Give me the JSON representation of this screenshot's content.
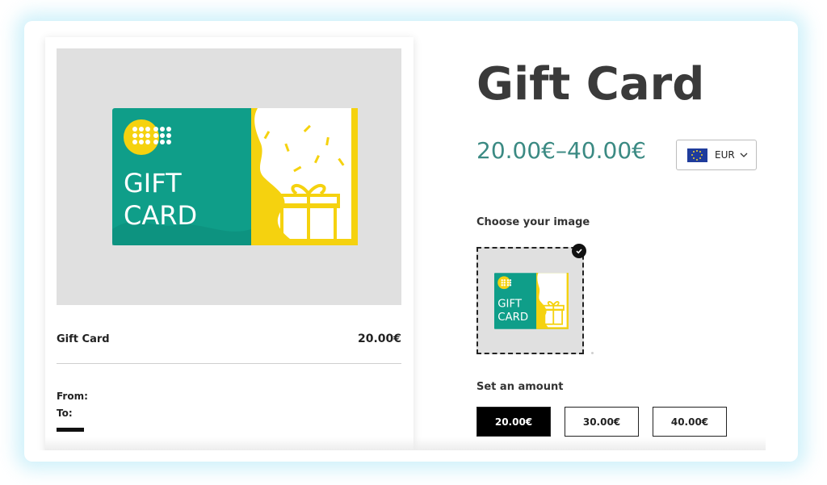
{
  "product": {
    "title": "Gift Card",
    "price_range": "20.00€–40.00€"
  },
  "currency": {
    "code": "EUR",
    "flag_icon": "eu-flag-icon"
  },
  "preview": {
    "title": "Gift Card",
    "price": "20.00€",
    "from_label": "From:",
    "to_label": "To:",
    "card_text_line1": "GIFT",
    "card_text_line2": "CARD"
  },
  "image_section": {
    "label": "Choose your image",
    "selected": true
  },
  "amount_section": {
    "label": "Set an amount",
    "options": [
      "20.00€",
      "30.00€",
      "40.00€"
    ],
    "selected_index": 0
  },
  "colors": {
    "card_teal": "#0f9e89",
    "card_yellow": "#f5d20f",
    "price_teal": "#3b8a83",
    "title_gray": "#3a3a3a"
  }
}
